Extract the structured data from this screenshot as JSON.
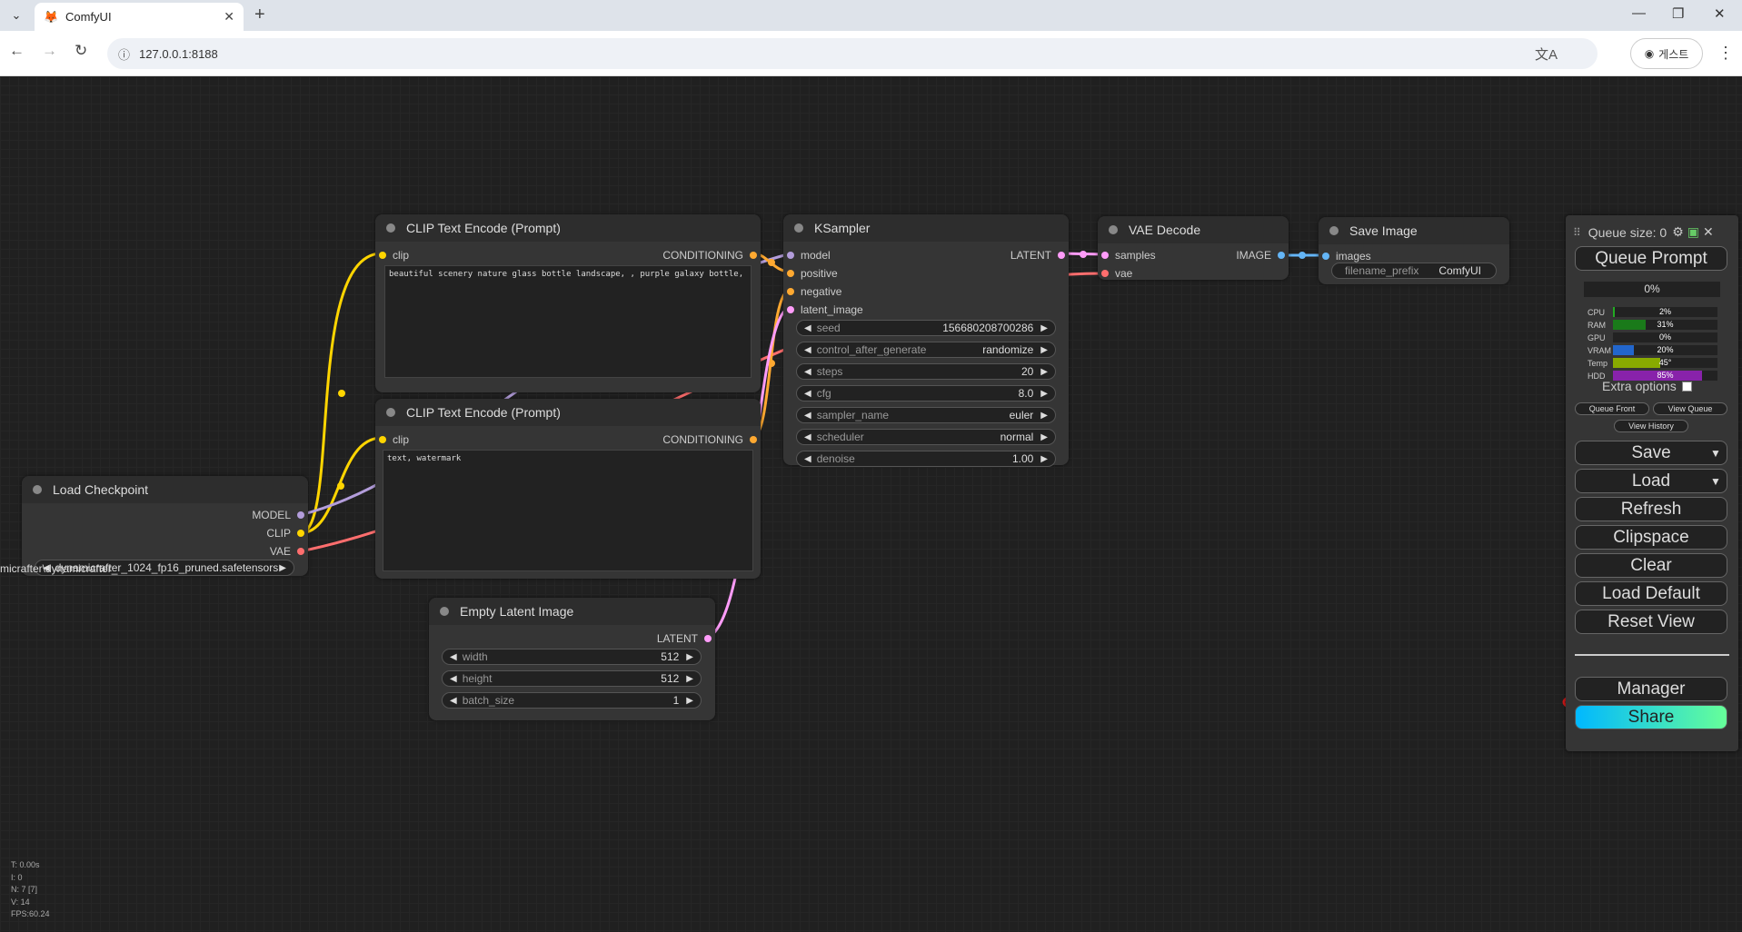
{
  "browser": {
    "tab_title": "ComfyUI",
    "url": "127.0.0.1:8188",
    "profile_label": "게스트"
  },
  "nodes": {
    "clip_pos": {
      "title": "CLIP Text Encode (Prompt)",
      "input": "clip",
      "output": "CONDITIONING",
      "text": "beautiful scenery nature glass bottle landscape, , purple galaxy bottle,"
    },
    "clip_neg": {
      "title": "CLIP Text Encode (Prompt)",
      "input": "clip",
      "output": "CONDITIONING",
      "text": "text, watermark"
    },
    "ksampler": {
      "title": "KSampler",
      "inputs": [
        "model",
        "positive",
        "negative",
        "latent_image"
      ],
      "output": "LATENT",
      "widgets": [
        {
          "label": "seed",
          "value": "156680208700286"
        },
        {
          "label": "control_after_generate",
          "value": "randomize"
        },
        {
          "label": "steps",
          "value": "20"
        },
        {
          "label": "cfg",
          "value": "8.0"
        },
        {
          "label": "sampler_name",
          "value": "euler"
        },
        {
          "label": "scheduler",
          "value": "normal"
        },
        {
          "label": "denoise",
          "value": "1.00"
        }
      ]
    },
    "vae_decode": {
      "title": "VAE Decode",
      "inputs": [
        "samples",
        "vae"
      ],
      "output": "IMAGE"
    },
    "save_image": {
      "title": "Save Image",
      "input": "images",
      "widget_label": "filename_prefix",
      "widget_value": "ComfyUI"
    },
    "load_checkpoint": {
      "title": "Load Checkpoint",
      "outputs": [
        "MODEL",
        "CLIP",
        "VAE"
      ],
      "ckpt_prefix": "micrafter\\dynamicrafter_",
      "ckpt_value": "dynamicrafter_1024_fp16_pruned.safetensors"
    },
    "empty_latent": {
      "title": "Empty Latent Image",
      "output": "LATENT",
      "widgets": [
        {
          "label": "width",
          "value": "512"
        },
        {
          "label": "height",
          "value": "512"
        },
        {
          "label": "batch_size",
          "value": "1"
        }
      ]
    }
  },
  "queue_panel": {
    "title": "Queue size: 0",
    "queue_prompt": "Queue Prompt",
    "progress": "0%",
    "monitor": [
      {
        "label": "CPU",
        "value": "2%",
        "fill": 0.02,
        "color": "#22aa22"
      },
      {
        "label": "RAM",
        "value": "31%",
        "fill": 0.31,
        "color": "#1a7a1a"
      },
      {
        "label": "GPU",
        "value": "0%",
        "fill": 0.0,
        "color": "#22aa22"
      },
      {
        "label": "VRAM",
        "value": "20%",
        "fill": 0.2,
        "color": "#2266cc"
      },
      {
        "label": "Temp",
        "value": "45°",
        "fill": 0.45,
        "color": "#88aa00"
      },
      {
        "label": "HDD",
        "value": "85%",
        "fill": 0.85,
        "color": "#8822aa"
      }
    ],
    "extra_options": "Extra options",
    "queue_front": "Queue Front",
    "view_queue": "View Queue",
    "view_history": "View History",
    "save": "Save",
    "load": "Load",
    "refresh": "Refresh",
    "clipspace": "Clipspace",
    "clear": "Clear",
    "load_default": "Load Default",
    "reset_view": "Reset View",
    "manager": "Manager",
    "share": "Share"
  },
  "stats": {
    "t": "T: 0.00s",
    "i": "I: 0",
    "n": "N: 7 [7]",
    "v": "V: 14",
    "fps": "FPS:60.24"
  },
  "colors": {
    "clip_link": "#ffd500",
    "model_link": "#b39ddb",
    "vae_link": "#ff6e6e",
    "latent_link": "#ff9cf9",
    "conditioning_link": "#ffa931",
    "image_link": "#64b5f6",
    "highlight": "#e01b1b"
  }
}
